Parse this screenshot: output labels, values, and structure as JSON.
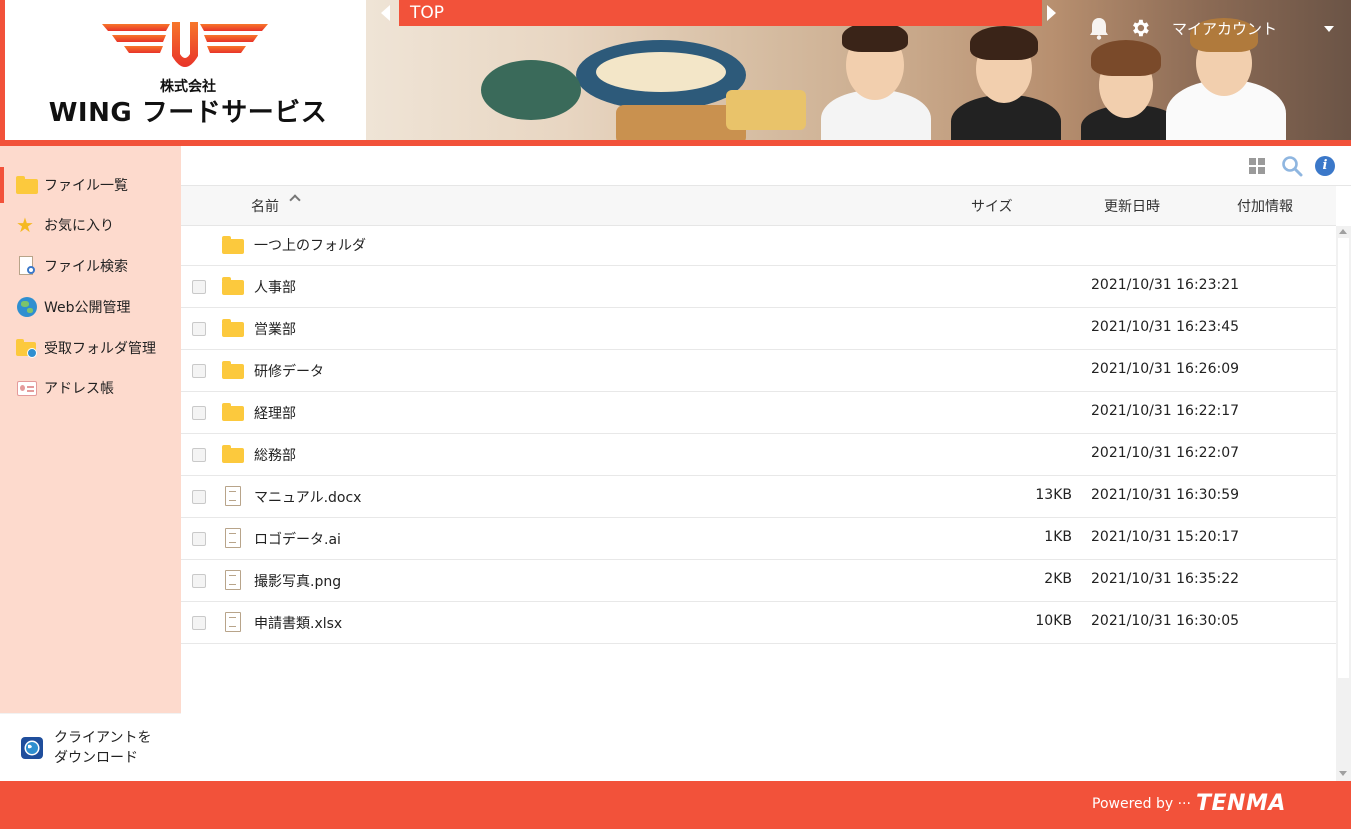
{
  "header": {
    "logo_sub": "株式会社",
    "logo_main": "WING フードサービス",
    "breadcrumb": "TOP",
    "account_label": "マイアカウント"
  },
  "sidebar": {
    "items": [
      {
        "label": "ファイル一覧",
        "icon": "folder-icon"
      },
      {
        "label": "お気に入り",
        "icon": "star-icon"
      },
      {
        "label": "ファイル検索",
        "icon": "file-search-icon"
      },
      {
        "label": "Web公開管理",
        "icon": "globe-icon"
      },
      {
        "label": "受取フォルダ管理",
        "icon": "folder-globe-icon"
      },
      {
        "label": "アドレス帳",
        "icon": "address-book-icon"
      }
    ],
    "download_line1": "クライアントを",
    "download_line2": "ダウンロード"
  },
  "table": {
    "headers": {
      "name": "名前",
      "size": "サイズ",
      "updated": "更新日時",
      "info": "付加情報"
    },
    "parent_folder": "一つ上のフォルダ",
    "rows": [
      {
        "type": "folder",
        "name": "人事部",
        "size": "",
        "date": "2021/10/31 16:23:21"
      },
      {
        "type": "folder",
        "name": "営業部",
        "size": "",
        "date": "2021/10/31 16:23:45"
      },
      {
        "type": "folder",
        "name": "研修データ",
        "size": "",
        "date": "2021/10/31 16:26:09"
      },
      {
        "type": "folder",
        "name": "経理部",
        "size": "",
        "date": "2021/10/31 16:22:17"
      },
      {
        "type": "folder",
        "name": "総務部",
        "size": "",
        "date": "2021/10/31 16:22:07"
      },
      {
        "type": "file",
        "name": "マニュアル.docx",
        "size": "13KB",
        "date": "2021/10/31 16:30:59"
      },
      {
        "type": "file",
        "name": "ロゴデータ.ai",
        "size": "1KB",
        "date": "2021/10/31 15:20:17"
      },
      {
        "type": "file",
        "name": "撮影写真.png",
        "size": "2KB",
        "date": "2021/10/31 16:35:22"
      },
      {
        "type": "file",
        "name": "申請書類.xlsx",
        "size": "10KB",
        "date": "2021/10/31 16:30:05"
      }
    ]
  },
  "footer": {
    "powered": "Powered by ···",
    "brand": "TENMA"
  },
  "colors": {
    "accent": "#f2523a",
    "sidebar_bg": "#fddacd",
    "folder": "#fcc93d",
    "info": "#3b78c9"
  }
}
